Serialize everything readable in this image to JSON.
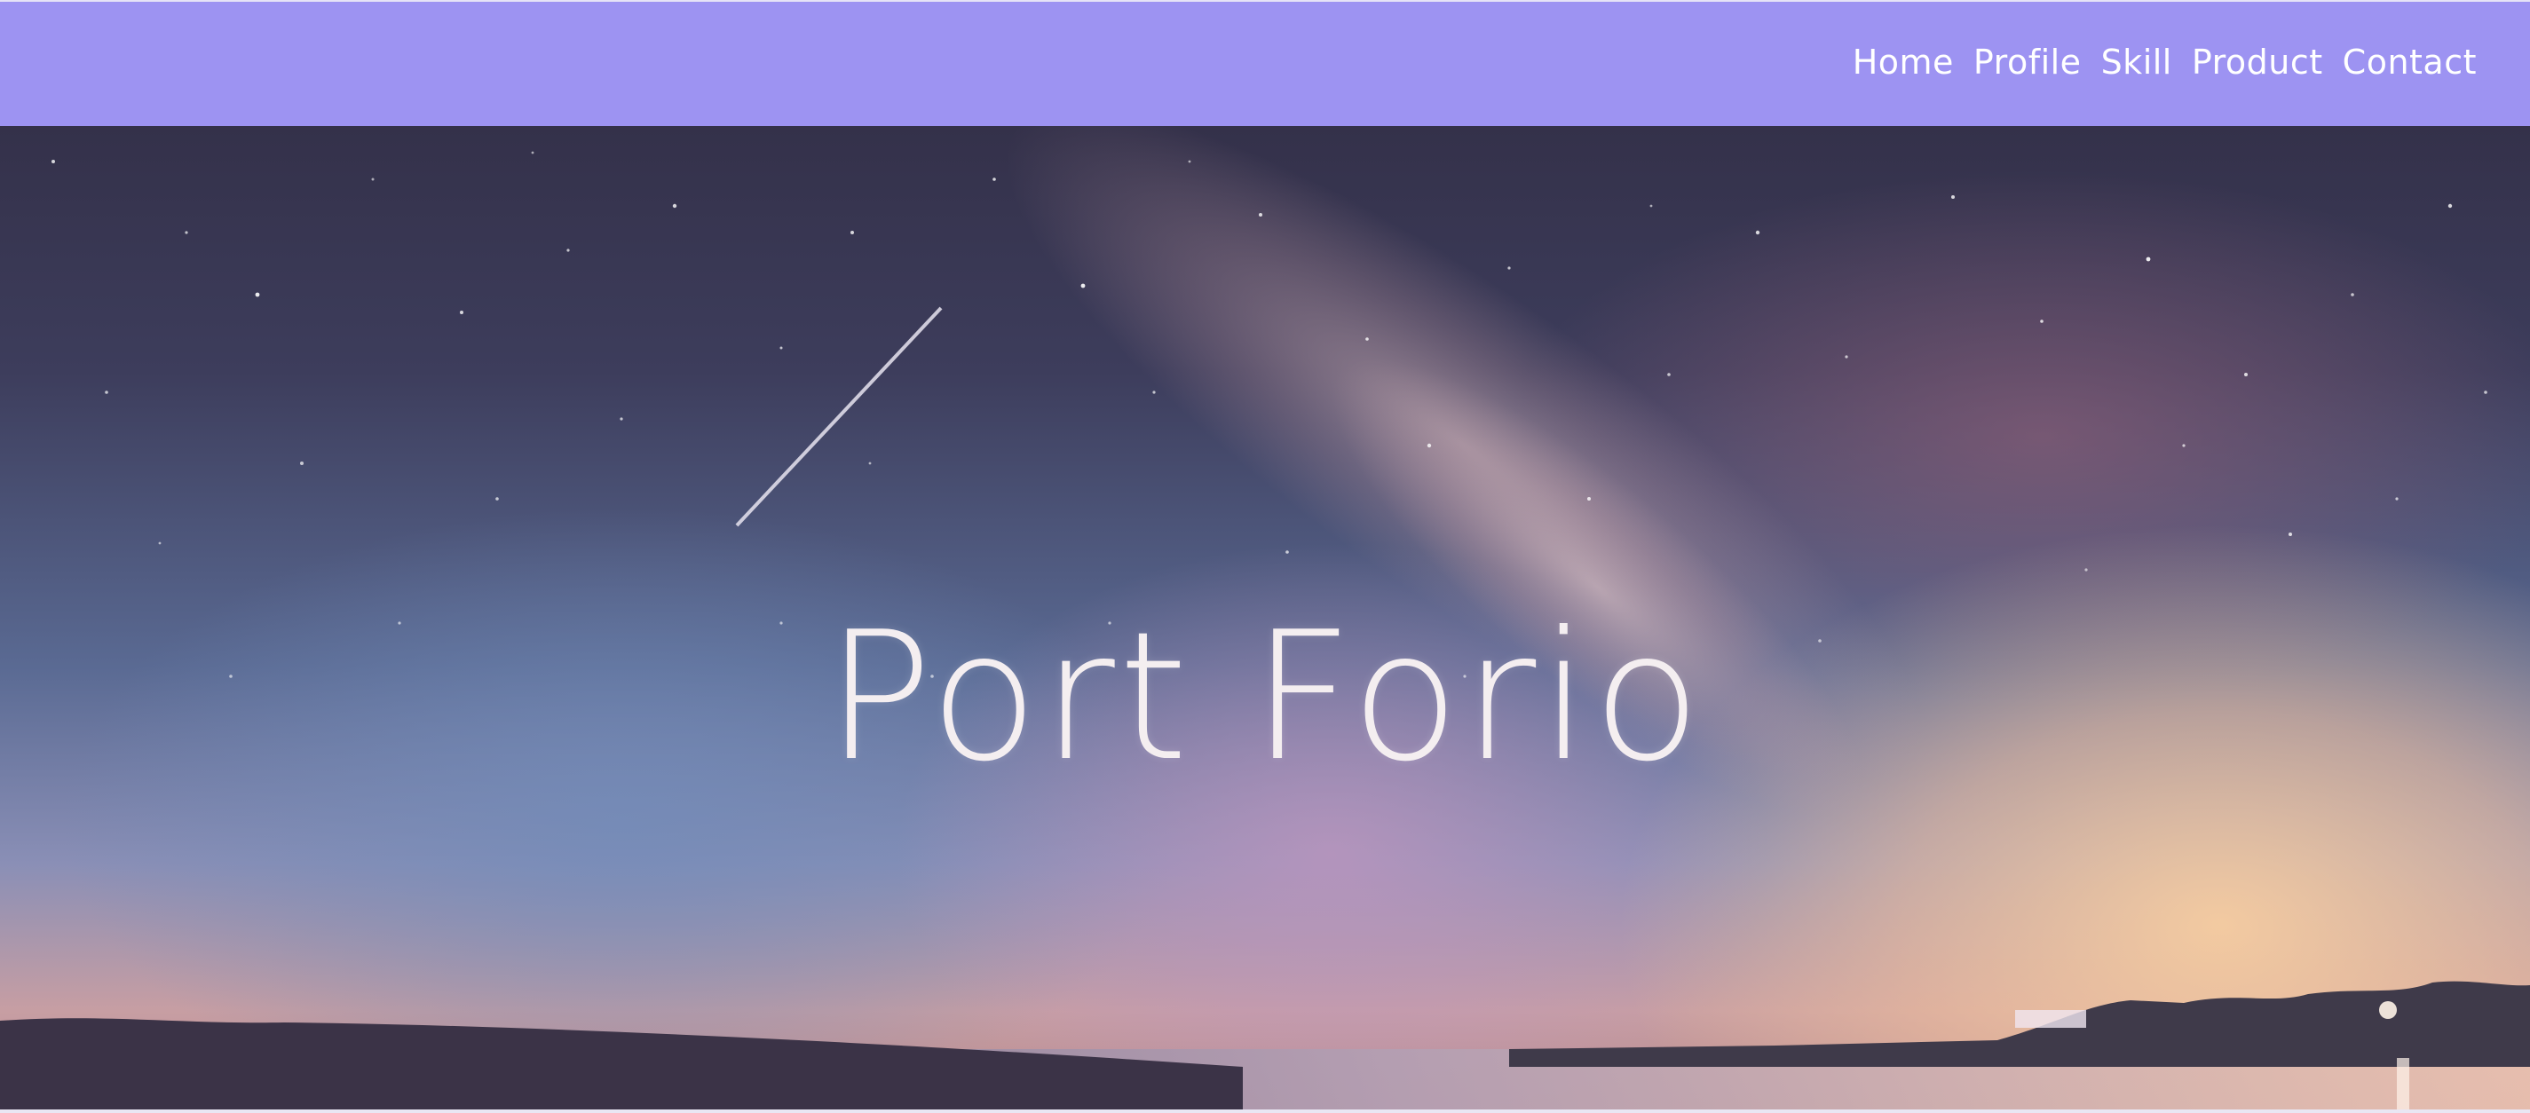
{
  "nav": {
    "items": [
      "Home",
      "Profile",
      "Skill",
      "Product",
      "Contact"
    ]
  },
  "hero": {
    "title": "Port Forio",
    "background": "night-sky-milky-way-photo"
  },
  "colors": {
    "header_bg": "#9d93f2",
    "nav_text": "#ffffff",
    "title_text": "#f4eef0"
  }
}
